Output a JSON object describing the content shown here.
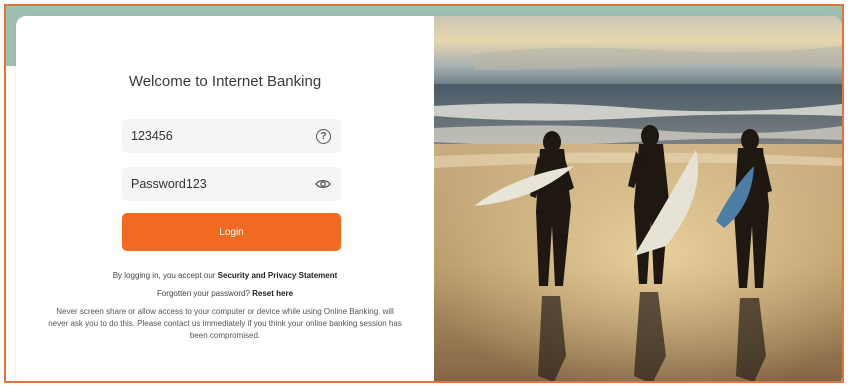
{
  "login": {
    "welcome": "Welcome to Internet Banking",
    "username_value": "123456",
    "password_value": "Password123",
    "login_label": "Login",
    "accept_prefix": "By logging in, you accept our",
    "accept_link": "Security and Privacy Statement",
    "forgot_prefix": "Forgotten your password?",
    "forgot_link": "Reset here",
    "warning": "Never screen share or allow access to your computer or device while using Online Banking. will never ask you to do this. Please contact us immediately if you think your online banking session has been compromised."
  },
  "colors": {
    "accent": "#f06a21",
    "frame_border": "#e3743b",
    "top_band": "#9fbfb5"
  },
  "icons": {
    "username_help": "question-circle-icon",
    "password_toggle": "eye-icon"
  }
}
